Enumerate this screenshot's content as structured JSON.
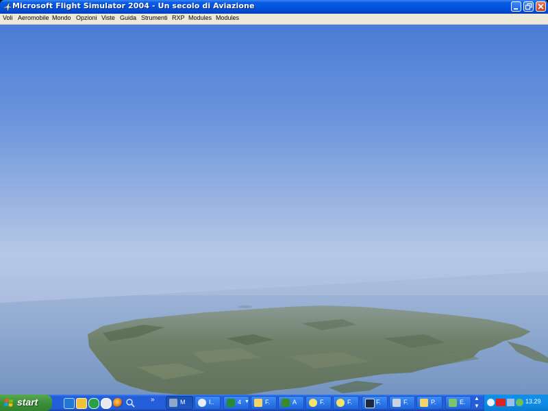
{
  "window": {
    "title": "Microsoft Flight Simulator 2004 - Un secolo di Aviazione",
    "controls": [
      "minimize",
      "restore",
      "close"
    ]
  },
  "menubar": {
    "items": [
      "Voli",
      "Aeromobile",
      "Mondo",
      "Opzioni",
      "Viste",
      "Guida",
      "Strumenti",
      "RXP",
      "Modules",
      "Modules"
    ]
  },
  "scene": {
    "description_icon": "landscape-view",
    "sky_top": "#4f7fd6",
    "sky_horizon": "#b9c9e6",
    "sea": "#7f9fc6",
    "land": "#6a7e66"
  },
  "taskbar": {
    "start_label": "start",
    "quicklaunch_icons": [
      "ie-icon",
      "winamp-icon",
      "messenger-icon",
      "media-icon",
      "firefox-icon",
      "search-icon"
    ],
    "chevron": "»",
    "tasks": [
      {
        "label": "M",
        "icon": "plane-icon",
        "active": true
      },
      {
        "label": "I..",
        "icon": "ie-icon",
        "active": false
      },
      {
        "label": "4",
        "icon": "excel-icon",
        "active": false
      },
      {
        "label": "F.",
        "icon": "folder-icon",
        "active": false
      },
      {
        "label": "A",
        "icon": "app-icon",
        "active": false
      },
      {
        "label": "F.",
        "icon": "fs-icon",
        "active": false
      },
      {
        "label": "F.",
        "icon": "fs-icon",
        "active": false
      },
      {
        "label": "F.",
        "icon": "window-icon",
        "active": false
      },
      {
        "label": "F.",
        "icon": "plane-icon",
        "active": false
      },
      {
        "label": "P.",
        "icon": "paint-icon",
        "active": false
      },
      {
        "label": "E.",
        "icon": "network-icon",
        "active": false
      }
    ],
    "clock": "13.29"
  }
}
